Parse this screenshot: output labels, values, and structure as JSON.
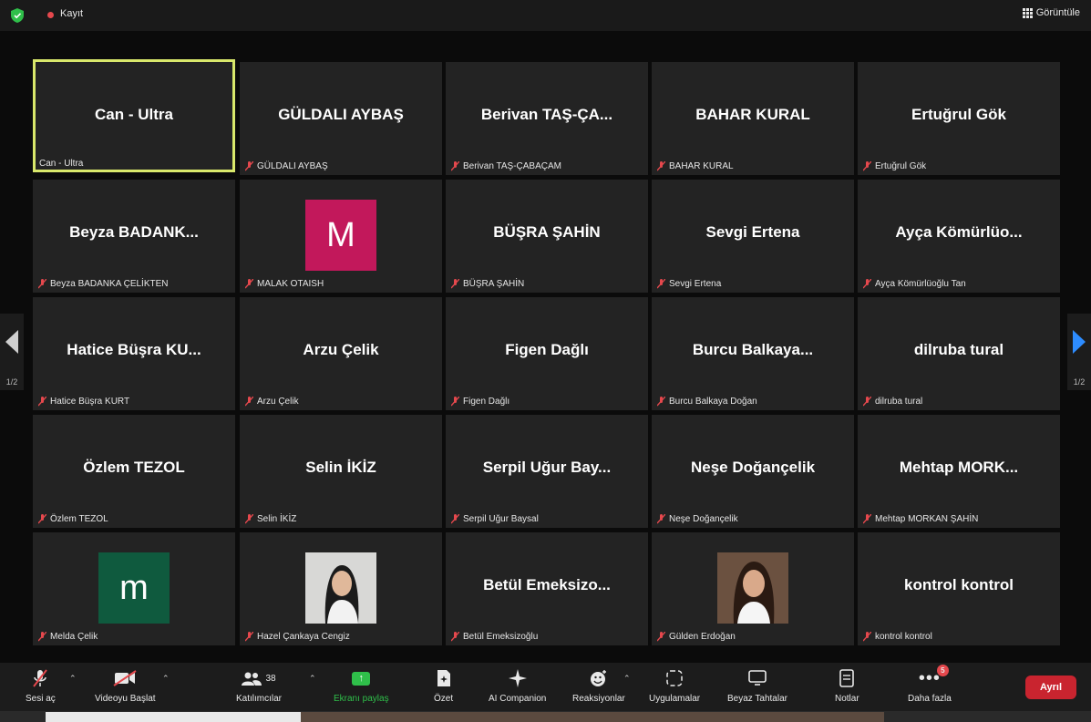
{
  "topbar": {
    "record_label": "Kayıt",
    "view_label": "Görüntüle"
  },
  "pager": {
    "left_page": "1/2",
    "right_page": "1/2"
  },
  "tiles": [
    {
      "big": "Can - Ultra",
      "label": "Can - Ultra"
    },
    {
      "big": "GÜLDALI AYBAŞ",
      "label": "GÜLDALI AYBAŞ"
    },
    {
      "big": "Berivan  TAŞ-ÇA...",
      "label": "Berivan TAŞ-ÇABAÇAM"
    },
    {
      "big": "BAHAR KURAL",
      "label": "BAHAR KURAL"
    },
    {
      "big": "Ertuğrul Gök",
      "label": "Ertuğrul Gök"
    },
    {
      "big": "Beyza  BADANK...",
      "label": "Beyza BADANKA ÇELİKTEN"
    },
    {
      "big": "M",
      "label": "MALAK OTAISH",
      "avatar_color": "#c2185b"
    },
    {
      "big": "BÜŞRA ŞAHİN",
      "label": "BÜŞRA ŞAHİN"
    },
    {
      "big": "Sevgi Ertena",
      "label": "Sevgi Ertena"
    },
    {
      "big": "Ayça  Kömürlüo...",
      "label": "Ayça Kömürlüoğlu Tan"
    },
    {
      "big": "Hatice  Büşra  KU...",
      "label": "Hatice Büşra KURT"
    },
    {
      "big": "Arzu Çelik",
      "label": "Arzu Çelik"
    },
    {
      "big": "Figen Dağlı",
      "label": "Figen Dağlı"
    },
    {
      "big": "Burcu  Balkaya...",
      "label": "Burcu Balkaya Doğan"
    },
    {
      "big": "dilruba tural",
      "label": "dilruba tural"
    },
    {
      "big": "Özlem TEZOL",
      "label": "Özlem TEZOL"
    },
    {
      "big": "Selin İKİZ",
      "label": "Selin İKİZ"
    },
    {
      "big": "Serpil  Uğur  Bay...",
      "label": "Serpil Uğur Baysal"
    },
    {
      "big": "Neşe Doğançelik",
      "label": "Neşe Doğançelik"
    },
    {
      "big": "Mehtap  MORK...",
      "label": "Mehtap MORKAN ŞAHİN"
    },
    {
      "big": "m",
      "label": "Melda Çelik",
      "avatar_color": "#0f5a3e"
    },
    {
      "big": "",
      "label": "Hazel Çankaya Cengiz"
    },
    {
      "big": "Betül  Emeksizo...",
      "label": "Betül Emeksizoğlu"
    },
    {
      "big": "",
      "label": "Gülden Erdoğan"
    },
    {
      "big": "kontrol kontrol",
      "label": "kontrol kontrol"
    }
  ],
  "toolbar": {
    "audio": "Sesi aç",
    "video": "Videoyu Başlat",
    "participants": "Katılımcılar",
    "participant_count": "38",
    "share": "Ekranı paylaş",
    "summary": "Özet",
    "ai": "AI Companion",
    "reactions": "Reaksiyonlar",
    "apps": "Uygulamalar",
    "whiteboard": "Beyaz Tahtalar",
    "notes": "Notlar",
    "more": "Daha fazla",
    "more_badge": "5",
    "leave": "Ayrıl"
  },
  "colors": {
    "accent_green": "#2fbf4a",
    "active_border": "#d9e86b",
    "leave_red": "#c9242f"
  }
}
